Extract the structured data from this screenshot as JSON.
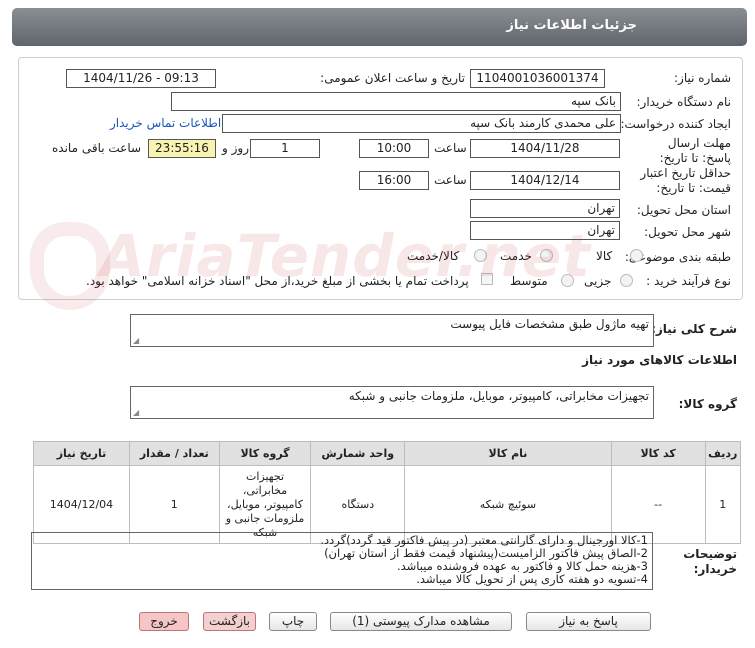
{
  "page": {
    "title": "جزئیات اطلاعات نیاز"
  },
  "form": {
    "need_number_label": "شماره نیاز:",
    "need_number": "1104001036001374",
    "announce_label": "تاریخ و ساعت اعلان عمومی:",
    "announce_value": "1404/11/26 - 09:13",
    "buyer_org_label": "نام دستگاه خریدار:",
    "buyer_org": "بانک سپه",
    "creator_label": "ایجاد کننده درخواست:",
    "creator": "علی محمدی کارمند بانک سپه",
    "contact_link": "اطلاعات تماس خریدار",
    "reply_deadline_label": "مهلت ارسال پاسخ: تا تاریخ:",
    "reply_date": "1404/11/28",
    "time_label": "ساعت",
    "reply_time": "10:00",
    "days_value": "1",
    "days_label": "روز و",
    "remaining_time": "23:55:16",
    "remaining_label": "ساعت باقی مانده",
    "price_validity_label": "حداقل تاریخ اعتبار قیمت: تا تاریخ:",
    "price_date": "1404/12/14",
    "price_time": "16:00",
    "province_label": "استان محل تحویل:",
    "province": "تهران",
    "city_label": "شهر محل تحویل:",
    "city": "تهران",
    "category_label": "طبقه بندی موضوعی:",
    "category_options": [
      "کالا",
      "خدمت",
      "کالا/خدمت"
    ],
    "process_label": "نوع فرآیند خرید :",
    "process_options": [
      "جزیی",
      "متوسط"
    ],
    "payment_note": "پرداخت تمام یا بخشی از مبلغ خرید،از محل \"اسناد خزانه اسلامی\" خواهد بود."
  },
  "description": {
    "label": "شرح کلی نیاز:",
    "value": "تهیه ماژول طبق مشخصات فایل پیوست"
  },
  "goods_info": {
    "heading": "اطلاعات کالاهای مورد نیاز",
    "group_label": "گروه کالا:",
    "group_value": "تجهیزات مخابراتی، کامپیوتر، موبایل، ملزومات جانبی و شبکه"
  },
  "table": {
    "headers": [
      "ردیف",
      "کد کالا",
      "نام کالا",
      "واحد شمارش",
      "گروه کالا",
      "تعداد / مقدار",
      "تاریخ نیاز"
    ],
    "rows": [
      [
        "1",
        "--",
        "سوئیچ شبکه",
        "دستگاه",
        "تجهیزات مخابراتی، کامپیوتر، موبایل، ملزومات جانبی و شبکه",
        "1",
        "1404/12/04"
      ]
    ]
  },
  "buyer_notes": {
    "label": "توضیحات خریدار:",
    "lines": [
      "1-کالا اورجینال و دارای گارانتی معتبر (در پیش فاکتور قید گردد)گردد.",
      "2-الصاق پیش فاکتور الزامیست(پیشنهاد قیمت فقط از استان تهران)",
      "3-هزینه حمل کالا و فاکتور به عهده فروشنده میباشد.",
      "4-تسویه دو هفته کاری پس از تحویل کالا میباشد."
    ]
  },
  "buttons": {
    "reply": "پاسخ به نیاز",
    "documents": "مشاهده مدارک پیوستی (1)",
    "print": "چاپ",
    "back": "بازگشت",
    "exit": "خروج"
  },
  "colors": {
    "accent_link": "#1a56b8",
    "title_bar": "#6d7378",
    "remaining_bg": "#f7f3b0"
  }
}
